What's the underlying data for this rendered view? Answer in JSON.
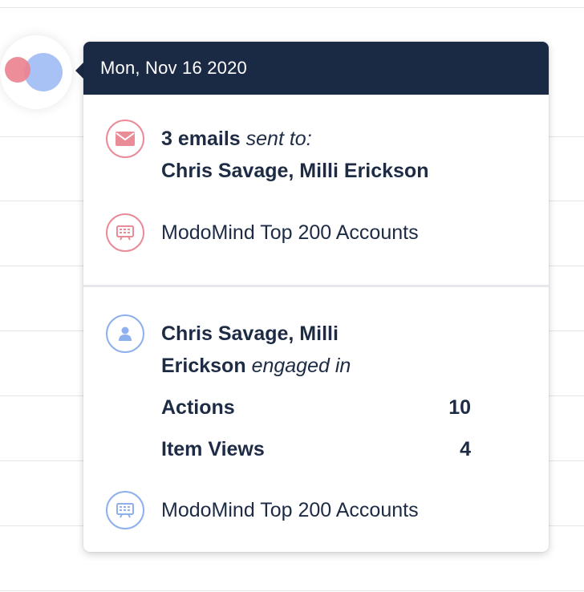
{
  "tooltip": {
    "date": "Mon, Nov 16 2020",
    "sent": {
      "count_text": "3 emails",
      "sent_to_text": "sent to:",
      "recipients": "Chris Savage, Milli Erickson",
      "icon": "envelope-icon"
    },
    "sent_stream": {
      "label": "ModoMind Top 200 Accounts",
      "icon": "presentation-board-icon"
    },
    "engaged": {
      "names_line1": "Chris Savage, Milli",
      "names_line2": "Erickson",
      "engaged_text": "engaged in",
      "icon": "person-icon",
      "stats": [
        {
          "label": "Actions",
          "value": "10"
        },
        {
          "label": "Item Views",
          "value": "4"
        }
      ]
    },
    "engaged_stream": {
      "label": "ModoMind Top 200 Accounts",
      "icon": "presentation-board-icon"
    }
  },
  "colors": {
    "header_bg": "#1b2a44",
    "email_accent": "#ea8c98",
    "engage_accent": "#8fb0ee",
    "text": "#1d2b45"
  }
}
